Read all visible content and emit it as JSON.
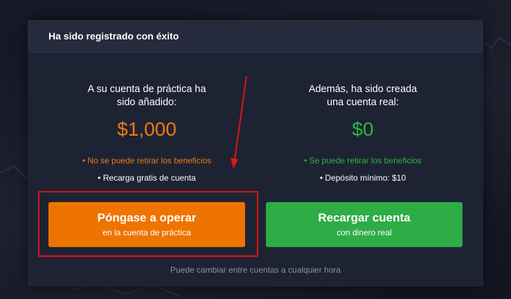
{
  "modal": {
    "title": "Ha sido registrado con éxito",
    "practice": {
      "intro_line1": "A su cuenta de práctica ha",
      "intro_line2": "sido añadido:",
      "amount": "$1,000",
      "note": "• No se puede retirar los beneficios",
      "note2": "• Recarga gratis de cuenta",
      "button_title": "Póngase a operar",
      "button_subtitle": "en la cuenta de práctica"
    },
    "real": {
      "intro_line1": "Además, ha sido creada",
      "intro_line2": "una cuenta real:",
      "amount": "$0",
      "note": "• Se puede retirar los beneficios",
      "note2": "• Depósito mínimo: $10",
      "button_title": "Recargar cuenta",
      "button_subtitle": "con dinero real"
    },
    "footer": "Puede cambiar entre cuentas a cualquier hora"
  },
  "colors": {
    "practice_accent": "#ef7a11",
    "real_accent": "#2eb445",
    "highlight": "#e01414"
  }
}
